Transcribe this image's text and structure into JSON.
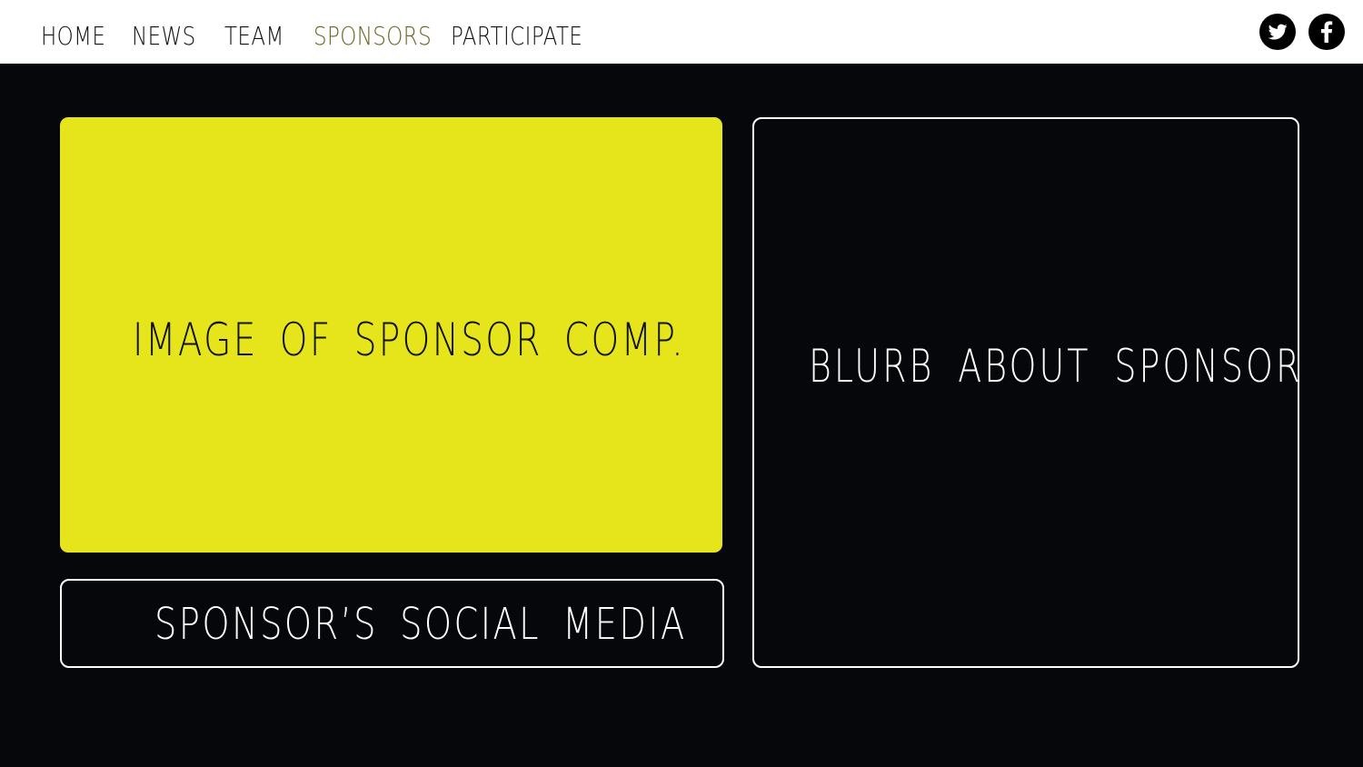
{
  "nav": {
    "links": [
      {
        "label": "HOME",
        "active": false
      },
      {
        "label": "NEWS",
        "active": false
      },
      {
        "label": "TEAM",
        "active": false
      },
      {
        "label": "SPONSORS",
        "active": true
      },
      {
        "label": "PARTICIPATE",
        "active": false
      }
    ],
    "social": [
      {
        "icon": "twitter-icon"
      },
      {
        "icon": "facebook-icon"
      }
    ]
  },
  "sponsor": {
    "image_placeholder": "IMAGE OF SPONSOR COMP.",
    "social_media": "SPONSOR’S SOCIAL MEDIA",
    "blurb": "BLURB ABOUT SPONSOR"
  },
  "colors": {
    "nav_background": "#ffffff",
    "page_background": "#06070a",
    "accent_yellow": "#e6e41b",
    "active_link": "#6b6320",
    "box_border": "#ffffff"
  }
}
